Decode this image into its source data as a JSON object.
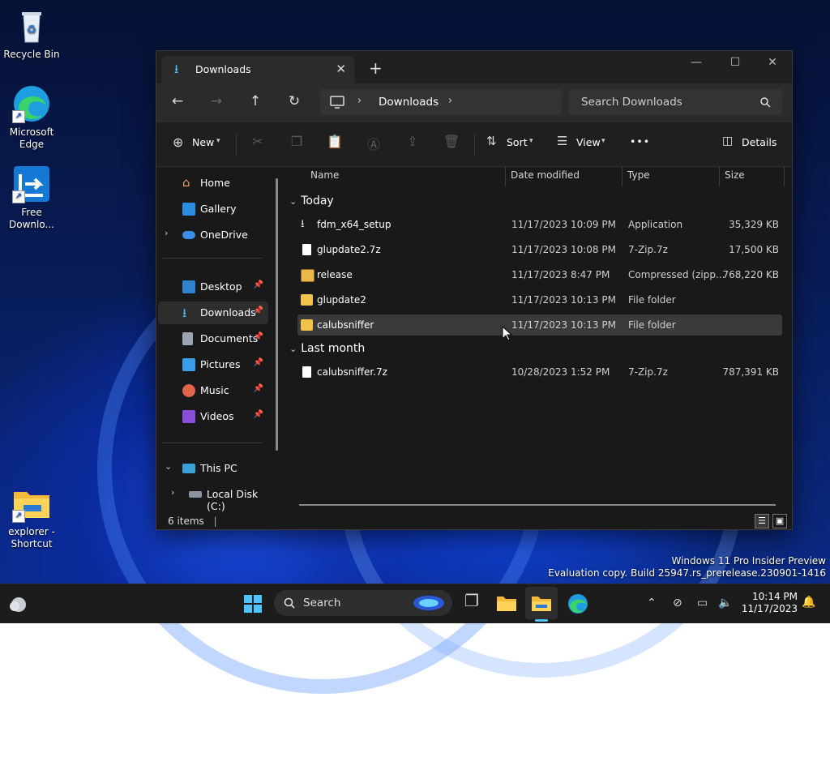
{
  "desktop": {
    "icons": [
      {
        "label": "Recycle Bin",
        "icon": "recycle-bin-icon"
      },
      {
        "label": "Microsoft Edge",
        "icon": "edge-icon"
      },
      {
        "label": "Free Downlo...",
        "icon": "free-download-manager-icon"
      },
      {
        "label": "explorer - Shortcut",
        "icon": "folder-icon"
      }
    ],
    "watermark": {
      "line1": "Windows 11 Pro Insider Preview",
      "line2": "Evaluation copy. Build 25947.rs_prerelease.230901-1416"
    }
  },
  "window": {
    "tab_title": "Downloads",
    "address": {
      "crumb": "Downloads"
    },
    "search": {
      "placeholder": "Search Downloads"
    },
    "commands": {
      "new": "New",
      "sort": "Sort",
      "view": "View",
      "more": "•••",
      "details": "Details"
    },
    "sidebar": {
      "items": [
        {
          "label": "Home"
        },
        {
          "label": "Gallery"
        },
        {
          "label": "OneDrive"
        },
        {
          "label": "Desktop"
        },
        {
          "label": "Downloads"
        },
        {
          "label": "Documents"
        },
        {
          "label": "Pictures"
        },
        {
          "label": "Music"
        },
        {
          "label": "Videos"
        },
        {
          "label": "This PC"
        },
        {
          "label": "Local Disk (C:)"
        }
      ]
    },
    "columns": {
      "name": "Name",
      "date": "Date modified",
      "type": "Type",
      "size": "Size"
    },
    "groups": {
      "today": "Today",
      "last_month": "Last month"
    },
    "files": [
      {
        "name": "fdm_x64_setup",
        "date": "11/17/2023 10:09 PM",
        "type": "Application",
        "size": "35,329 KB"
      },
      {
        "name": "glupdate2.7z",
        "date": "11/17/2023 10:08 PM",
        "type": "7-Zip.7z",
        "size": "17,500 KB"
      },
      {
        "name": "release",
        "date": "11/17/2023 8:47 PM",
        "type": "Compressed (zipp...",
        "size": "768,220 KB"
      },
      {
        "name": "glupdate2",
        "date": "11/17/2023 10:13 PM",
        "type": "File folder",
        "size": ""
      },
      {
        "name": "calubsniffer",
        "date": "11/17/2023 10:13 PM",
        "type": "File folder",
        "size": ""
      },
      {
        "name": "calubsniffer.7z",
        "date": "10/28/2023 1:52 PM",
        "type": "7-Zip.7z",
        "size": "787,391 KB"
      }
    ],
    "status": "6 items"
  },
  "taskbar": {
    "search_label": "Search",
    "time": "10:14 PM",
    "date": "11/17/2023"
  },
  "colors": {
    "accent": "#4cc2ff",
    "folder": "#f3c24a"
  }
}
